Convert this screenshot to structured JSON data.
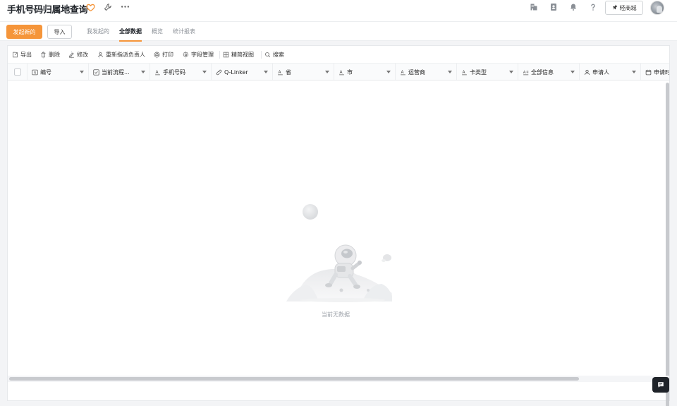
{
  "app": {
    "title": "手机号码归属地查询"
  },
  "topbar": {
    "mall_label": "轻商城"
  },
  "actions": {
    "primary_label": "发起新的",
    "import_label": "导入"
  },
  "tabs": [
    {
      "label": "我发起的"
    },
    {
      "label": "全部数据"
    },
    {
      "label": "概览"
    },
    {
      "label": "统计报表"
    }
  ],
  "toolbar": [
    {
      "label": "导出",
      "icon": "export-icon"
    },
    {
      "label": "删除",
      "icon": "trash-icon"
    },
    {
      "label": "修改",
      "icon": "edit-icon"
    },
    {
      "label": "重新指派负责人",
      "icon": "user-icon"
    },
    {
      "label": "打印",
      "icon": "printer-icon"
    },
    {
      "label": "字段管理",
      "icon": "gear-icon"
    },
    {
      "label": "精简视图",
      "icon": "grid-icon"
    },
    {
      "label": "搜索",
      "icon": "search-icon"
    }
  ],
  "columns": [
    {
      "label": "编号",
      "type_icon": "number-icon"
    },
    {
      "label": "当前流程...",
      "type_icon": "check-square-icon"
    },
    {
      "label": "手机号码",
      "type_icon": "text-icon"
    },
    {
      "label": "Q-Linker",
      "type_icon": "link-icon"
    },
    {
      "label": "省",
      "type_icon": "text-icon"
    },
    {
      "label": "市",
      "type_icon": "text-icon"
    },
    {
      "label": "运营商",
      "type_icon": "text-icon"
    },
    {
      "label": "卡类型",
      "type_icon": "text-icon"
    },
    {
      "label": "全部信息",
      "type_icon": "multiline-text-icon"
    },
    {
      "label": "申请人",
      "type_icon": "person-icon"
    },
    {
      "label": "申请时间",
      "type_icon": "calendar-icon"
    }
  ],
  "empty": {
    "text": "当前无数据"
  },
  "colors": {
    "accent": "#f5953a",
    "text": "#1f2329",
    "muted": "#9ea3aa"
  }
}
